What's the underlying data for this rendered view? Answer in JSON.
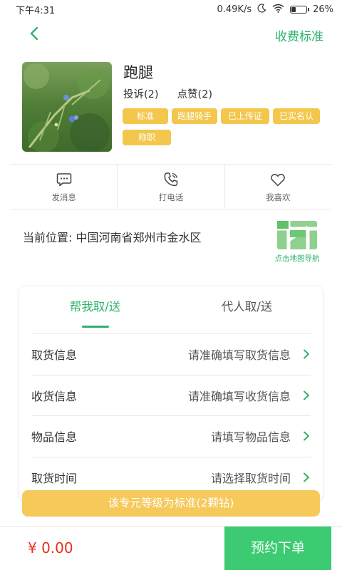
{
  "status_bar": {
    "time": "下午4:31",
    "network_speed": "0.49K/s",
    "battery": "26%",
    "battery_level": 0.26
  },
  "nav": {
    "back_icon": "chevron-left-icon",
    "right_label": "收费标准"
  },
  "profile": {
    "name": "跑腿",
    "complaints": "投诉(2)",
    "likes": "点赞(2)",
    "tags": [
      "标准",
      "跑腿骑手",
      "已上传证件",
      "已实名认证",
      "称职"
    ]
  },
  "actions": [
    {
      "icon": "chat-bubble-icon",
      "label": "发消息"
    },
    {
      "icon": "phone-icon",
      "label": "打电话"
    },
    {
      "icon": "heart-icon",
      "label": "我喜欢"
    }
  ],
  "location": {
    "text": "当前位置: 中国河南省郑州市金水区",
    "map_label": "点击地图导航"
  },
  "order": {
    "tabs": [
      {
        "label": "帮我取/送",
        "active": true
      },
      {
        "label": "代人取/送",
        "active": false
      }
    ],
    "rows": [
      {
        "label": "取货信息",
        "value": "请准确填写取货信息"
      },
      {
        "label": "收货信息",
        "value": "请准确填写收货信息"
      },
      {
        "label": "物品信息",
        "value": "请填写物品信息"
      },
      {
        "label": "取货时间",
        "value": "请选择取货时间"
      }
    ]
  },
  "level_banner": "该专元等级为标准(2颗钻)",
  "bottom": {
    "price": "¥ 0.00",
    "submit_label": "预约下单"
  },
  "colors": {
    "accent_green": "#2fb26c",
    "submit_green": "#3ccb73",
    "tag_yellow": "#f2c74c",
    "price_red": "#e8301e"
  }
}
